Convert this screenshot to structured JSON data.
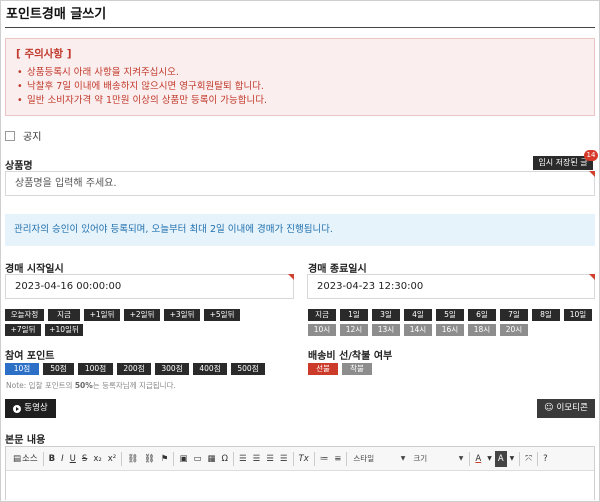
{
  "page": {
    "title": "포인트경매 글쓰기"
  },
  "notice": {
    "title": "[ 주의사항 ]",
    "items": [
      "상품등록시 아래 사항을 지켜주십시오.",
      "낙찰후 7일 이내에 배송하지 않으시면 영구회원탈퇴 합니다.",
      "일반 소비자가격 약 1만원 이상의 상품만 등록이 가능합니다."
    ]
  },
  "notice_checkbox": {
    "label": "공지",
    "checked": false
  },
  "product": {
    "label": "상품명",
    "placeholder": "상품명을 입력해 주세요.",
    "temp_save_label": "임시 저장된 글",
    "temp_save_count": "14"
  },
  "info": {
    "text": "관리자의 승인이 있어야 등록되며, 오늘부터 최대 2일 이내에 경매가 진행됩니다."
  },
  "start": {
    "label": "경매 시작일시",
    "value": "2023-04-16 00:00:00",
    "buttons": [
      "오늘자정",
      "지금",
      "+1일뒤",
      "+2일뒤",
      "+3일뒤",
      "+5일뒤",
      "+7일뒤",
      "+10일뒤"
    ]
  },
  "end": {
    "label": "경매 종료일시",
    "value": "2023-04-23 12:30:00",
    "buttons": [
      "지금",
      "1일",
      "3일",
      "4일",
      "5일",
      "6일",
      "7일",
      "8일",
      "10일"
    ],
    "hour_buttons": [
      "10시",
      "12시",
      "13시",
      "14시",
      "16시",
      "18시",
      "20시"
    ]
  },
  "points": {
    "label": "참여 포인트",
    "options": [
      "10점",
      "50점",
      "100점",
      "200점",
      "300점",
      "400점",
      "500점"
    ],
    "selected": "10점",
    "note_prefix": "Note: 입찰 포인트의 ",
    "note_bold": "50%",
    "note_suffix": "는 등록자님께 지급됩니다."
  },
  "shipping": {
    "label": "배송비 선/착불 여부",
    "options": [
      "선불",
      "착불"
    ],
    "selected": "선불"
  },
  "media": {
    "video_label": "동영상",
    "emoticon_label": "이모티콘"
  },
  "body": {
    "label": "본문 내용"
  },
  "editor_toolbar": {
    "source_label": "소스",
    "style_label": "스타일",
    "size_label": "크기",
    "bold": "B",
    "italic": "I",
    "underline": "U",
    "strike": "S",
    "subscript": "x₂",
    "superscript": "x²",
    "omega": "Ω",
    "help": "?",
    "font_color": "A",
    "bg_color": "A",
    "clear_format": "Tx"
  },
  "colors": {
    "notice_red": "#c0392b",
    "info_blue": "#1f6fae",
    "selected_blue": "#2c6fc7",
    "selected_red": "#cc3a2a",
    "dark_button": "#2a2a2a"
  }
}
